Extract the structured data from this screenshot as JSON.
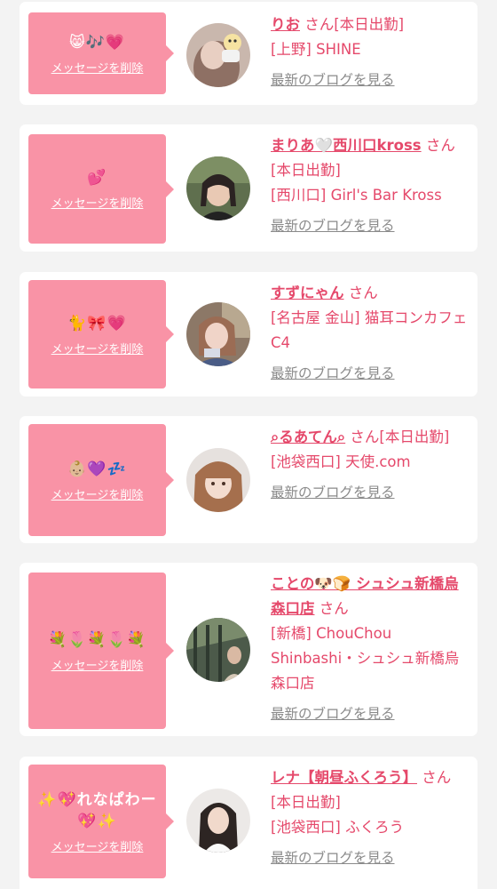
{
  "common": {
    "delete_label": "メッセージを削除",
    "blog_label": "最新のブログを見る",
    "honorific": "さん"
  },
  "colors": {
    "bubble": "#f993a6",
    "name": "#e5496b",
    "link_gray": "#8a8a8a"
  },
  "entries": [
    {
      "emoji": "😸🎶💗",
      "name": "りお",
      "status": "[本日出勤]",
      "shop": "[上野] SHINE"
    },
    {
      "emoji": "💕",
      "name": "まりあ🤍西川口kross",
      "status": "[本日出勤]",
      "shop": "[西川口] Girl's Bar Kross"
    },
    {
      "emoji": "🐈🎀💗",
      "name": "すずにゃん",
      "status": "",
      "shop": "[名古屋 金山] 猫耳コンカフェ C4"
    },
    {
      "emoji": "👶🏼💜💤",
      "name": "⌕るあてん⌕",
      "status": "[本日出勤]",
      "shop": "[池袋西口] 天使.com"
    },
    {
      "emoji": "💐🌷💐🌷💐",
      "name": "ことの🐶🍞 シュシュ新橋烏森口店",
      "status": "",
      "shop": "[新橋] ChouChou Shinbashi・シュシュ新橋烏森口店"
    },
    {
      "emoji": "✨💖れなぱわー💖✨",
      "name": "レナ【朝昼ふくろう】",
      "status": "[本日出勤]",
      "shop": "[池袋西口] ふくろう"
    }
  ]
}
